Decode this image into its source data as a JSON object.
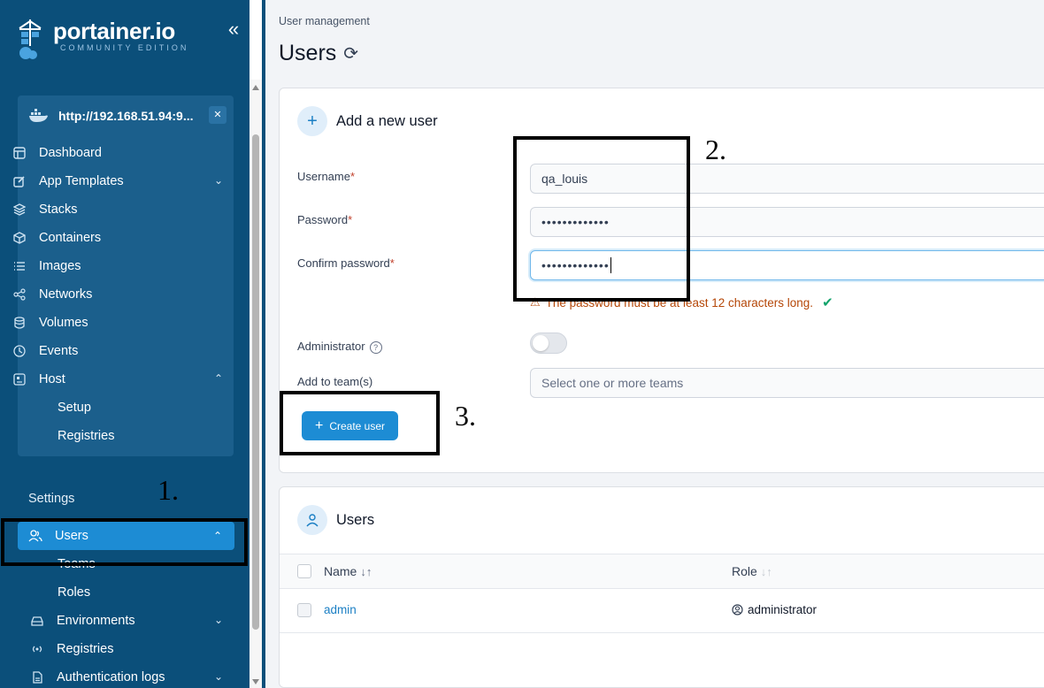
{
  "brand": {
    "name": "portainer.io",
    "edition": "COMMUNITY EDITION"
  },
  "sidebar": {
    "environment_url": "http://192.168.51.94:9...",
    "env_items": [
      {
        "label": "Dashboard",
        "icon": "layout-icon"
      },
      {
        "label": "App Templates",
        "icon": "edit-icon"
      },
      {
        "label": "Stacks",
        "icon": "layers-icon"
      },
      {
        "label": "Containers",
        "icon": "box-icon"
      },
      {
        "label": "Images",
        "icon": "list-icon"
      },
      {
        "label": "Networks",
        "icon": "share-icon"
      },
      {
        "label": "Volumes",
        "icon": "database-icon"
      },
      {
        "label": "Events",
        "icon": "clock-icon"
      },
      {
        "label": "Host",
        "icon": "server-icon"
      }
    ],
    "host_sub": [
      "Setup",
      "Registries"
    ],
    "settings_label": "Settings",
    "users_label": "Users",
    "users_sub": [
      "Teams",
      "Roles"
    ],
    "settings_items": [
      {
        "label": "Environments",
        "icon": "hdd-icon"
      },
      {
        "label": "Registries",
        "icon": "radio-icon"
      },
      {
        "label": "Authentication logs",
        "icon": "file-icon"
      }
    ]
  },
  "main": {
    "breadcrumb": "User management",
    "title": "Users",
    "add_user": {
      "title": "Add a new user",
      "username_label": "Username",
      "username_value": "qa_louis",
      "password_label": "Password",
      "password_value": "•••••••••••••",
      "confirm_label": "Confirm password",
      "confirm_value": "•••••••••••••",
      "hint": "The password must be at least 12 characters long.",
      "admin_label": "Administrator",
      "teams_label": "Add to team(s)",
      "teams_placeholder": "Select one or more teams",
      "create_button": "Create user"
    },
    "users_table": {
      "title": "Users",
      "col_name": "Name",
      "col_role": "Role",
      "rows": [
        {
          "name": "admin",
          "role": "administrator"
        }
      ]
    }
  },
  "annotations": [
    "1.",
    "2.",
    "3."
  ],
  "colors": {
    "sidebar_bg": "#0b4f7a",
    "active_item": "#1d8cd4",
    "primary": "#1d8cd4",
    "warning": "#b54708",
    "success": "#12a36b"
  }
}
